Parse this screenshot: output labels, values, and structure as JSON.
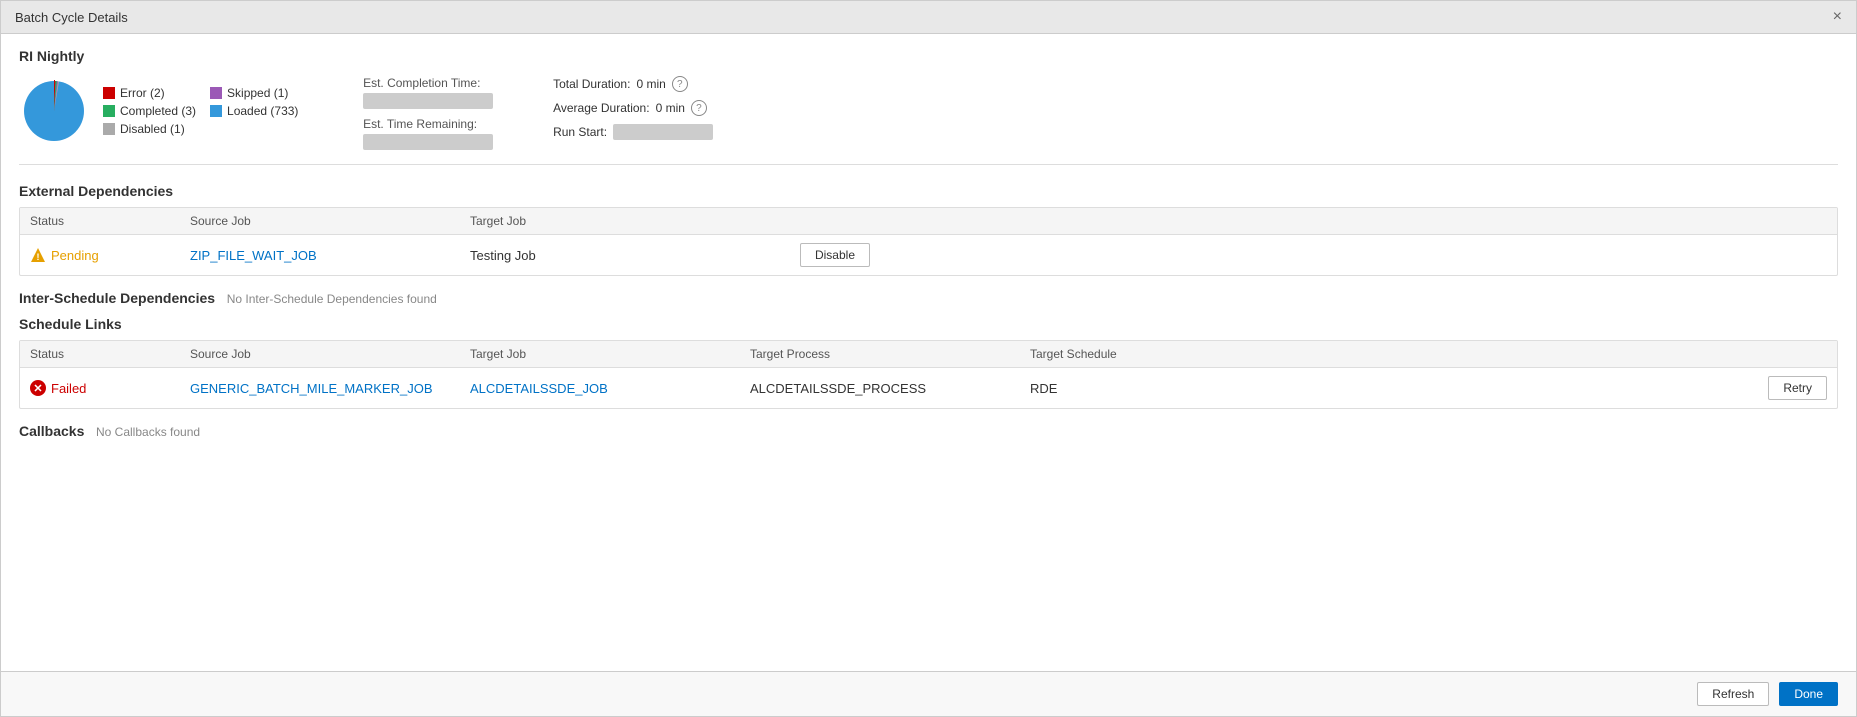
{
  "window": {
    "title": "Batch Cycle Details",
    "close_label": "×"
  },
  "batch": {
    "name": "RI Nightly"
  },
  "legend": {
    "items": [
      {
        "label": "Error (2)",
        "color": "#c00"
      },
      {
        "label": "Skipped (1)",
        "color": "#9b59b6"
      },
      {
        "label": "Completed (3)",
        "color": "#27ae60"
      },
      {
        "label": "Loaded (733)",
        "color": "#3498db"
      },
      {
        "label": "Disabled (1)",
        "color": "#aaa"
      }
    ]
  },
  "stats": {
    "est_completion_label": "Est. Completion Time:",
    "est_remaining_label": "Est. Time Remaining:",
    "total_duration_label": "Total Duration:",
    "total_duration_value": "0 min",
    "avg_duration_label": "Average Duration:",
    "avg_duration_value": "0 min",
    "run_start_label": "Run Start:"
  },
  "external_deps": {
    "section_title": "External Dependencies",
    "columns": {
      "status": "Status",
      "source_job": "Source Job",
      "target_job": "Target Job"
    },
    "rows": [
      {
        "status": "Pending",
        "source_job": "ZIP_FILE_WAIT_JOB",
        "target_job": "Testing Job",
        "action": "Disable"
      }
    ]
  },
  "inter_schedule": {
    "section_title": "Inter-Schedule Dependencies",
    "no_data": "No Inter-Schedule Dependencies found"
  },
  "schedule_links": {
    "section_title": "Schedule Links",
    "columns": {
      "status": "Status",
      "source_job": "Source Job",
      "target_job": "Target Job",
      "target_process": "Target Process",
      "target_schedule": "Target Schedule"
    },
    "rows": [
      {
        "status": "Failed",
        "source_job": "GENERIC_BATCH_MILE_MARKER_JOB",
        "target_job": "ALCDETAILSSDE_JOB",
        "target_process": "ALCDETAILSSDE_PROCESS",
        "target_schedule": "RDE",
        "action": "Retry"
      }
    ]
  },
  "callbacks": {
    "section_title": "Callbacks",
    "no_data": "No Callbacks found"
  },
  "footer": {
    "refresh_label": "Refresh",
    "done_label": "Done"
  }
}
